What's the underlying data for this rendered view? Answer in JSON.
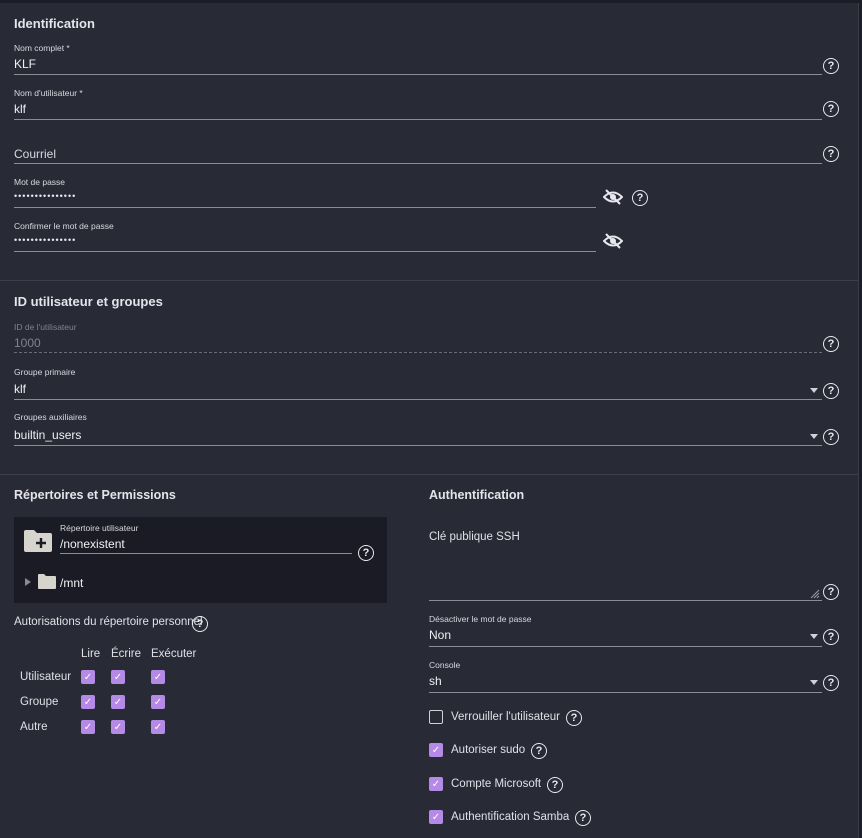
{
  "identification": {
    "title": "Identification",
    "full_name": {
      "label": "Nom complet *",
      "value": "KLF"
    },
    "username": {
      "label": "Nom d'utilisateur *",
      "value": "klf"
    },
    "email": {
      "placeholder": "Courriel"
    },
    "password": {
      "label": "Mot de passe",
      "value": "•••••••••••••••"
    },
    "confirm": {
      "label": "Confirmer le mot de passe",
      "value": "•••••••••••••••"
    }
  },
  "ids": {
    "title": "ID utilisateur et groupes",
    "uid": {
      "label": "ID de l'utilisateur",
      "value": "1000"
    },
    "primary": {
      "label": "Groupe primaire",
      "value": "klf"
    },
    "aux": {
      "label": "Groupes auxiliaires",
      "value": "builtin_users"
    }
  },
  "dirs": {
    "title": "Répertoires et Permissions",
    "home": {
      "label": "Répertoire utilisateur",
      "value": "/nonexistent"
    },
    "tree": [
      {
        "label": "/mnt"
      }
    ],
    "perm_title": "Autorisations du répertoire personnel",
    "cols": [
      "Lire",
      "Écrire",
      "Exécuter"
    ],
    "rows": [
      {
        "label": "Utilisateur",
        "checked": [
          true,
          true,
          true
        ]
      },
      {
        "label": "Groupe",
        "checked": [
          true,
          true,
          true
        ]
      },
      {
        "label": "Autre",
        "checked": [
          true,
          true,
          true
        ]
      }
    ]
  },
  "auth": {
    "title": "Authentification",
    "ssh": {
      "placeholder": "Clé publique SSH"
    },
    "disable_pw": {
      "label": "Désactiver le mot de passe",
      "value": "Non"
    },
    "shell": {
      "label": "Console",
      "value": "sh"
    },
    "checks": [
      {
        "label": "Verrouiller l'utilisateur",
        "checked": false
      },
      {
        "label": "Autoriser sudo",
        "checked": true
      },
      {
        "label": "Compte Microsoft",
        "checked": true
      },
      {
        "label": "Authentification Samba",
        "checked": true
      }
    ]
  },
  "colors": {
    "accent": "#b48ae6",
    "background": "#282a36"
  }
}
